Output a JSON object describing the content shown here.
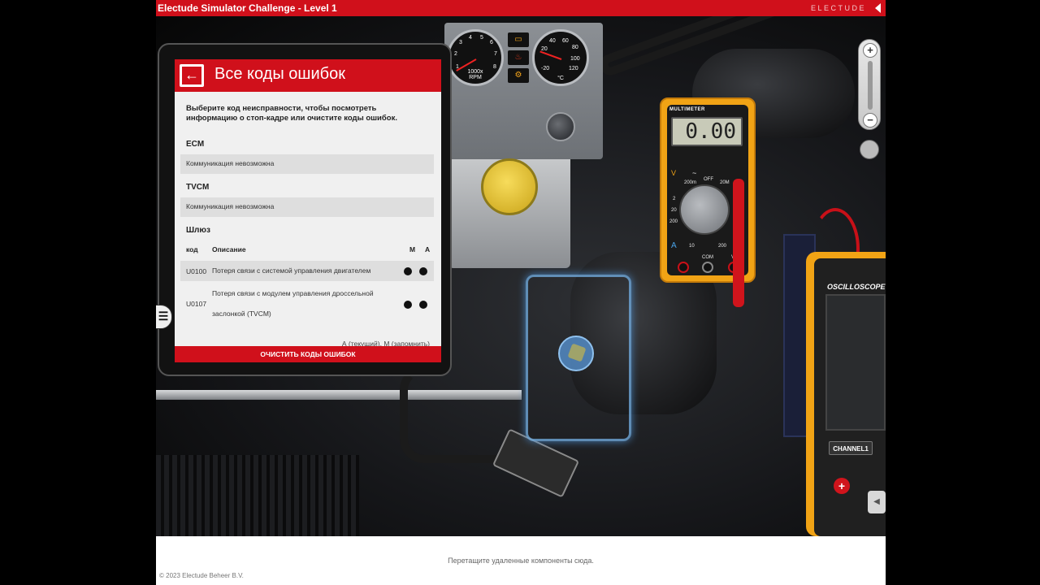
{
  "window": {
    "title": "Electude Simulator Challenge - Level 1",
    "brand": "ELECTUDE",
    "accent": "#d0101b"
  },
  "gauges": {
    "rpm_ticks": [
      "1",
      "2",
      "3",
      "4",
      "5",
      "6",
      "7",
      "8"
    ],
    "rpm_caption": "1000x\nRPM",
    "temp_ticks": [
      "40",
      "60",
      "80",
      "100",
      "120",
      "20",
      "-20"
    ],
    "temp_caption": "°C",
    "warning_icons": [
      "battery-warning-icon",
      "oil-pressure-icon",
      "check-engine-icon"
    ]
  },
  "multimeter": {
    "title": "MULTIMETER",
    "reading": "0.00",
    "labels": [
      "V",
      "~",
      "200m",
      "OFF",
      "20M",
      "2",
      "20",
      "200",
      "A",
      "10",
      "200",
      "COM",
      "VΩ"
    ]
  },
  "oscilloscope": {
    "title": "OSCILLOSCOPE",
    "channel_label": "CHANNEL1",
    "plus_label": "+"
  },
  "zoom": {
    "in_label": "+",
    "out_label": "−"
  },
  "tablet": {
    "title": "Все коды ошибок",
    "intro": "Выберите код неисправности, чтобы посмотреть информацию о стоп-кадре или очистите коды ошибок.",
    "modules": [
      {
        "name": "ECM",
        "status": "Коммуникация невозможна"
      },
      {
        "name": "TVCM",
        "status": "Коммуникация невозможна"
      }
    ],
    "gateway": {
      "name": "Шлюз",
      "columns": {
        "code": "код",
        "description": "Описание",
        "m": "M",
        "a": "A"
      },
      "rows": [
        {
          "code": "U0100",
          "description": "Потеря связи с системой управления двигателем",
          "m": true,
          "a": true
        },
        {
          "code": "U0107",
          "description": "Потеря связи с модулем управления дроссельной заслонкой (TVCM)",
          "m": true,
          "a": true
        }
      ]
    },
    "legend": "А (текущий), М (запомнить)",
    "clear_button": "ОЧИСТИТЬ КОДЫ ОШИБОК",
    "menu_icon": "hamburger-menu-icon"
  },
  "footer": {
    "drop_hint": "Перетащите удаленные компоненты сюда.",
    "copyright": "© 2023 Electude Beheer B.V."
  }
}
